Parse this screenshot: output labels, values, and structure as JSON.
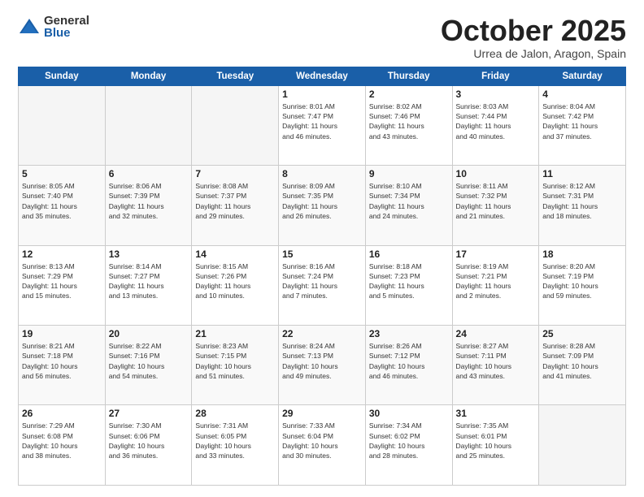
{
  "logo": {
    "general": "General",
    "blue": "Blue"
  },
  "header": {
    "month": "October 2025",
    "location": "Urrea de Jalon, Aragon, Spain"
  },
  "weekdays": [
    "Sunday",
    "Monday",
    "Tuesday",
    "Wednesday",
    "Thursday",
    "Friday",
    "Saturday"
  ],
  "weeks": [
    [
      {
        "day": "",
        "info": ""
      },
      {
        "day": "",
        "info": ""
      },
      {
        "day": "",
        "info": ""
      },
      {
        "day": "1",
        "info": "Sunrise: 8:01 AM\nSunset: 7:47 PM\nDaylight: 11 hours\nand 46 minutes."
      },
      {
        "day": "2",
        "info": "Sunrise: 8:02 AM\nSunset: 7:46 PM\nDaylight: 11 hours\nand 43 minutes."
      },
      {
        "day": "3",
        "info": "Sunrise: 8:03 AM\nSunset: 7:44 PM\nDaylight: 11 hours\nand 40 minutes."
      },
      {
        "day": "4",
        "info": "Sunrise: 8:04 AM\nSunset: 7:42 PM\nDaylight: 11 hours\nand 37 minutes."
      }
    ],
    [
      {
        "day": "5",
        "info": "Sunrise: 8:05 AM\nSunset: 7:40 PM\nDaylight: 11 hours\nand 35 minutes."
      },
      {
        "day": "6",
        "info": "Sunrise: 8:06 AM\nSunset: 7:39 PM\nDaylight: 11 hours\nand 32 minutes."
      },
      {
        "day": "7",
        "info": "Sunrise: 8:08 AM\nSunset: 7:37 PM\nDaylight: 11 hours\nand 29 minutes."
      },
      {
        "day": "8",
        "info": "Sunrise: 8:09 AM\nSunset: 7:35 PM\nDaylight: 11 hours\nand 26 minutes."
      },
      {
        "day": "9",
        "info": "Sunrise: 8:10 AM\nSunset: 7:34 PM\nDaylight: 11 hours\nand 24 minutes."
      },
      {
        "day": "10",
        "info": "Sunrise: 8:11 AM\nSunset: 7:32 PM\nDaylight: 11 hours\nand 21 minutes."
      },
      {
        "day": "11",
        "info": "Sunrise: 8:12 AM\nSunset: 7:31 PM\nDaylight: 11 hours\nand 18 minutes."
      }
    ],
    [
      {
        "day": "12",
        "info": "Sunrise: 8:13 AM\nSunset: 7:29 PM\nDaylight: 11 hours\nand 15 minutes."
      },
      {
        "day": "13",
        "info": "Sunrise: 8:14 AM\nSunset: 7:27 PM\nDaylight: 11 hours\nand 13 minutes."
      },
      {
        "day": "14",
        "info": "Sunrise: 8:15 AM\nSunset: 7:26 PM\nDaylight: 11 hours\nand 10 minutes."
      },
      {
        "day": "15",
        "info": "Sunrise: 8:16 AM\nSunset: 7:24 PM\nDaylight: 11 hours\nand 7 minutes."
      },
      {
        "day": "16",
        "info": "Sunrise: 8:18 AM\nSunset: 7:23 PM\nDaylight: 11 hours\nand 5 minutes."
      },
      {
        "day": "17",
        "info": "Sunrise: 8:19 AM\nSunset: 7:21 PM\nDaylight: 11 hours\nand 2 minutes."
      },
      {
        "day": "18",
        "info": "Sunrise: 8:20 AM\nSunset: 7:19 PM\nDaylight: 10 hours\nand 59 minutes."
      }
    ],
    [
      {
        "day": "19",
        "info": "Sunrise: 8:21 AM\nSunset: 7:18 PM\nDaylight: 10 hours\nand 56 minutes."
      },
      {
        "day": "20",
        "info": "Sunrise: 8:22 AM\nSunset: 7:16 PM\nDaylight: 10 hours\nand 54 minutes."
      },
      {
        "day": "21",
        "info": "Sunrise: 8:23 AM\nSunset: 7:15 PM\nDaylight: 10 hours\nand 51 minutes."
      },
      {
        "day": "22",
        "info": "Sunrise: 8:24 AM\nSunset: 7:13 PM\nDaylight: 10 hours\nand 49 minutes."
      },
      {
        "day": "23",
        "info": "Sunrise: 8:26 AM\nSunset: 7:12 PM\nDaylight: 10 hours\nand 46 minutes."
      },
      {
        "day": "24",
        "info": "Sunrise: 8:27 AM\nSunset: 7:11 PM\nDaylight: 10 hours\nand 43 minutes."
      },
      {
        "day": "25",
        "info": "Sunrise: 8:28 AM\nSunset: 7:09 PM\nDaylight: 10 hours\nand 41 minutes."
      }
    ],
    [
      {
        "day": "26",
        "info": "Sunrise: 7:29 AM\nSunset: 6:08 PM\nDaylight: 10 hours\nand 38 minutes."
      },
      {
        "day": "27",
        "info": "Sunrise: 7:30 AM\nSunset: 6:06 PM\nDaylight: 10 hours\nand 36 minutes."
      },
      {
        "day": "28",
        "info": "Sunrise: 7:31 AM\nSunset: 6:05 PM\nDaylight: 10 hours\nand 33 minutes."
      },
      {
        "day": "29",
        "info": "Sunrise: 7:33 AM\nSunset: 6:04 PM\nDaylight: 10 hours\nand 30 minutes."
      },
      {
        "day": "30",
        "info": "Sunrise: 7:34 AM\nSunset: 6:02 PM\nDaylight: 10 hours\nand 28 minutes."
      },
      {
        "day": "31",
        "info": "Sunrise: 7:35 AM\nSunset: 6:01 PM\nDaylight: 10 hours\nand 25 minutes."
      },
      {
        "day": "",
        "info": ""
      }
    ]
  ]
}
